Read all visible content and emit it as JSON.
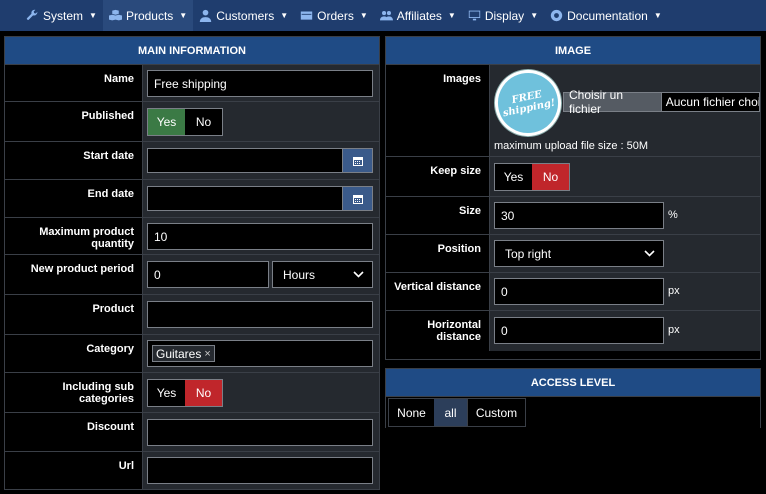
{
  "nav": {
    "items": [
      {
        "label": "System",
        "icon": "wrench-icon"
      },
      {
        "label": "Products",
        "icon": "cubes-icon"
      },
      {
        "label": "Customers",
        "icon": "user-icon"
      },
      {
        "label": "Orders",
        "icon": "credit-card-icon"
      },
      {
        "label": "Affiliates",
        "icon": "users-icon"
      },
      {
        "label": "Display",
        "icon": "monitor-icon"
      },
      {
        "label": "Documentation",
        "icon": "lifebuoy-icon"
      }
    ]
  },
  "main": {
    "title": "MAIN INFORMATION",
    "name_label": "Name",
    "name_value": "Free shipping",
    "published_label": "Published",
    "yes": "Yes",
    "no": "No",
    "start_label": "Start date",
    "end_label": "End date",
    "maxqty_label": "Maximum product quantity",
    "maxqty_value": "10",
    "period_label": "New product period",
    "period_value": "0",
    "period_unit": "Hours",
    "product_label": "Product",
    "category_label": "Category",
    "category_tag": "Guitares",
    "tag_remove": "×",
    "subcat_label": "Including sub categories",
    "discount_label": "Discount",
    "url_label": "Url"
  },
  "image": {
    "title": "IMAGE",
    "images_label": "Images",
    "badge_line1": "FREE",
    "badge_line2": "shipping!",
    "choose_file": "Choisir un fichier",
    "no_file": "Aucun fichier choisi",
    "max_upload": "maximum upload file size : 50M",
    "keep_label": "Keep size",
    "size_label": "Size",
    "size_value": "30",
    "size_unit": "%",
    "position_label": "Position",
    "position_value": "Top right",
    "vdist_label": "Vertical distance",
    "vdist_value": "0",
    "hdist_label": "Horizontal distance",
    "hdist_value": "0",
    "px": "px"
  },
  "access": {
    "title": "ACCESS LEVEL",
    "options": [
      "None",
      "all",
      "Custom"
    ]
  },
  "colors": {
    "nav_bg": "#1f3d6e",
    "header_bg": "#1f4b85",
    "yes_green": "#3b7a45",
    "no_red": "#c0262b"
  }
}
